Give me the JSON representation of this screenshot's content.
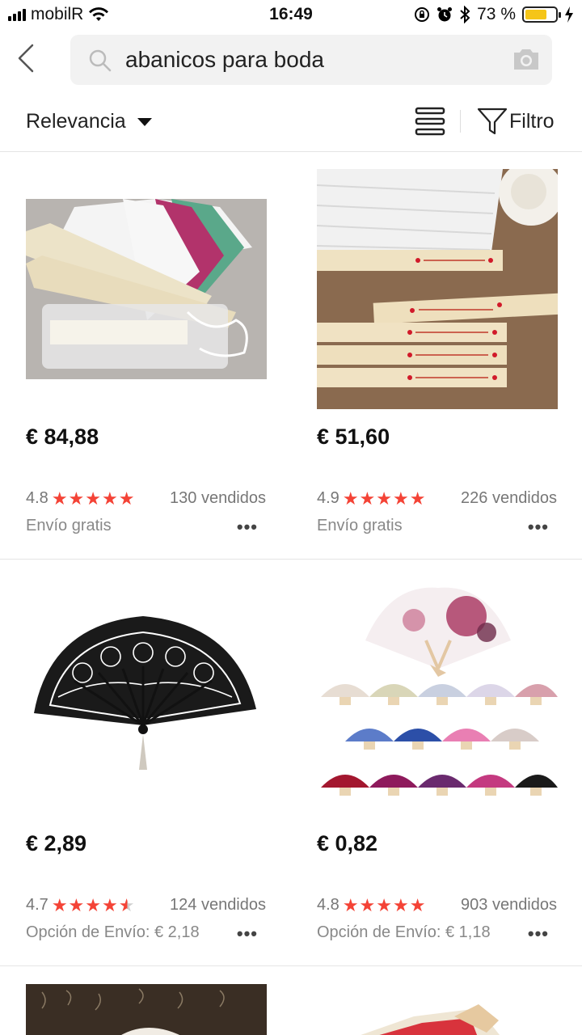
{
  "status_bar": {
    "carrier": "mobilR",
    "time": "16:49",
    "battery_percent": "73 %",
    "battery_level": 0.73
  },
  "search": {
    "query": "abanicos para boda"
  },
  "toolbar": {
    "sort_label": "Relevancia",
    "filter_label": "Filtro"
  },
  "products": [
    {
      "price": "€ 84,88",
      "rating": "4.8",
      "stars": 5,
      "sold": "130 vendidos",
      "shipping": "Envío gratis",
      "more": "•••"
    },
    {
      "price": "€ 51,60",
      "rating": "4.9",
      "stars": 5,
      "sold": "226 vendidos",
      "shipping": "Envío gratis",
      "more": "•••"
    },
    {
      "price": "€ 2,89",
      "rating": "4.7",
      "stars": 4.5,
      "sold": "124 vendidos",
      "shipping": "Opción de Envío: € 2,18",
      "more": "•••"
    },
    {
      "price": "€ 0,82",
      "rating": "4.8",
      "stars": 5,
      "sold": "903 vendidos",
      "shipping": "Opción de Envío: € 1,18",
      "more": "•••"
    }
  ],
  "colors": {
    "star": "#f44336",
    "battery": "#f5c518"
  },
  "icons": [
    "back-arrow-icon",
    "search-icon",
    "camera-icon",
    "caret-down-icon",
    "list-view-icon",
    "filter-funnel-icon",
    "more-dots-icon",
    "star-icon"
  ]
}
